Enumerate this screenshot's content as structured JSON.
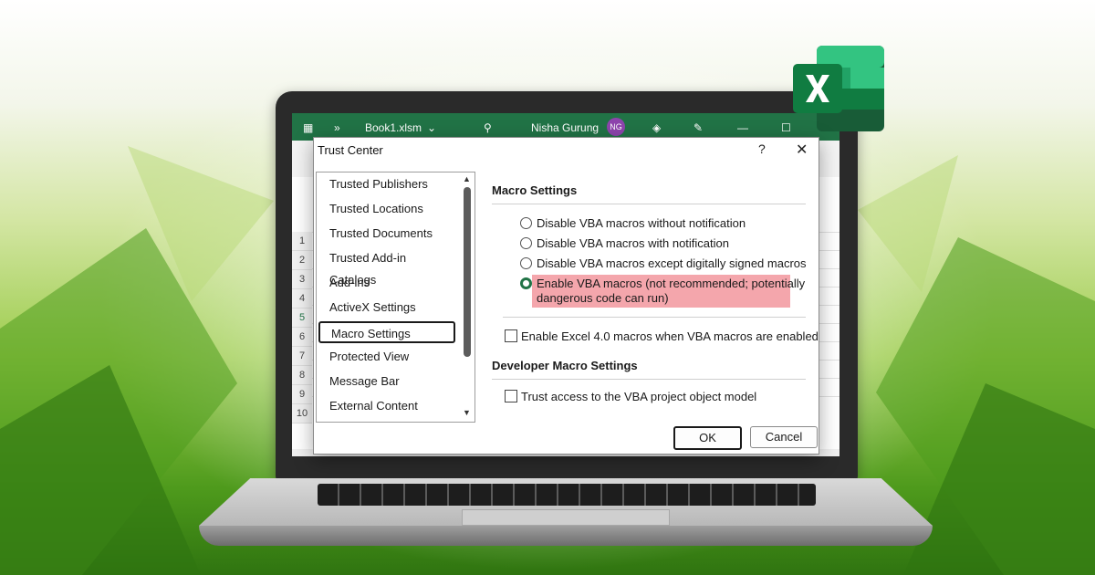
{
  "excel": {
    "filename": "Book1.xlsm",
    "user_name": "Nisha Gurung",
    "user_initials": "NG",
    "row_numbers": [
      "1",
      "2",
      "3",
      "4",
      "5",
      "6",
      "7",
      "8",
      "9",
      "10"
    ]
  },
  "dialog": {
    "title": "Trust Center",
    "help_label": "?",
    "close_label": "✕",
    "nav_items": [
      "Trusted Publishers",
      "Trusted Locations",
      "Trusted Documents",
      "Trusted Add-in Catalogs",
      "Add-ins",
      "ActiveX Settings",
      "Macro Settings",
      "Protected View",
      "Message Bar",
      "External Content"
    ],
    "selected_nav": "Macro Settings",
    "macro_section_title": "Macro Settings",
    "macro_options": [
      "Disable VBA macros without notification",
      "Disable VBA macros with notification",
      "Disable VBA macros except digitally signed macros",
      "Enable VBA macros (not recommended; potentially",
      "dangerous code can run)"
    ],
    "selected_option": "Enable VBA macros (not recommended; potentially dangerous code can run)",
    "excel4_checkbox": "Enable Excel 4.0 macros when VBA macros are enabled",
    "developer_section_title": "Developer Macro Settings",
    "vba_access_checkbox": "Trust access to the VBA project object model",
    "ok_label": "OK",
    "cancel_label": "Cancel"
  },
  "colors": {
    "excel_green": "#217346",
    "highlight": "#f4a6ac"
  }
}
